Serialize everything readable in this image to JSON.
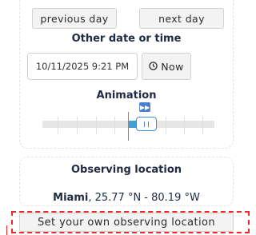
{
  "nav": {
    "previous_label": "previous day",
    "next_label": "next day"
  },
  "datetime": {
    "heading": "Other date or time",
    "value": "10/11/2025 9:21 PM",
    "now_label": "Now",
    "now_icon": "clock-icon"
  },
  "animation": {
    "heading": "Animation",
    "play_icon": "fast-forward-icon",
    "position_fraction": 0.57
  },
  "location": {
    "heading": "Observing location",
    "city": "Miami",
    "coords": ", 25.77 °N - 80.19 °W",
    "set_label": "Set your own observing location"
  },
  "colors": {
    "text": "#1f2a44",
    "accent_blue": "#3fa0d6",
    "highlight_red": "#ee2a2a"
  }
}
